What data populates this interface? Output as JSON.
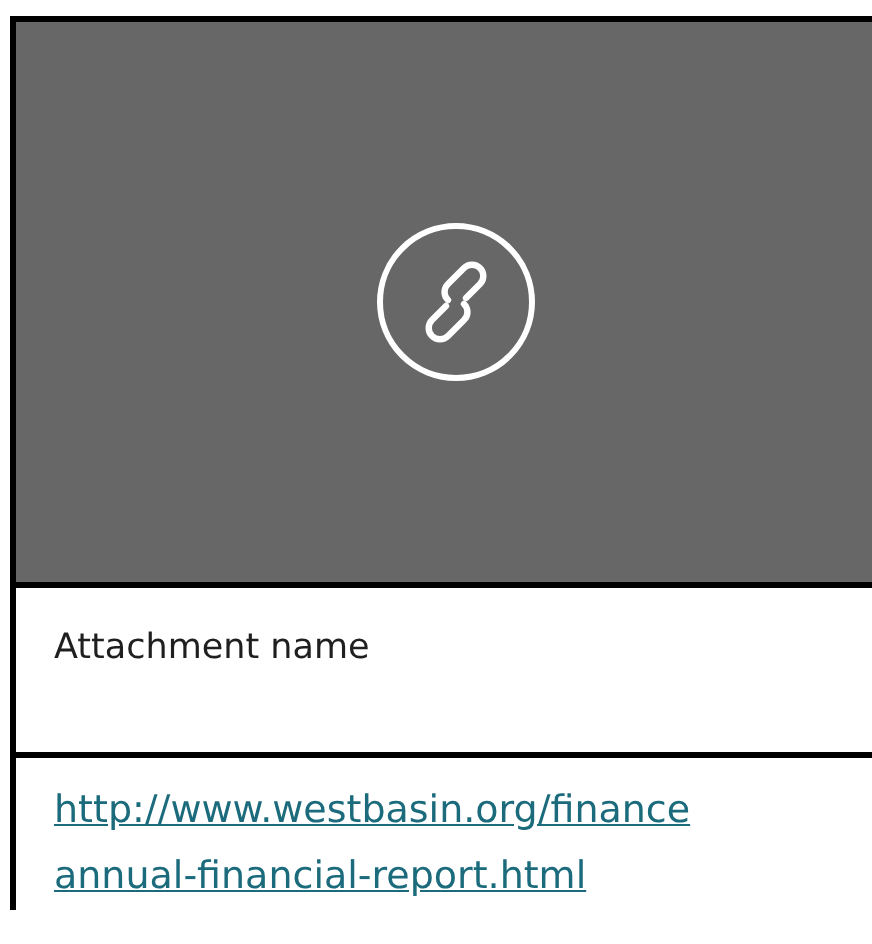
{
  "attachment": {
    "preview": {
      "kind": "link"
    },
    "name_label": "Attachment name",
    "link_lines": [
      "http://www.westbasin.org/finance",
      "annual-financial-report.html"
    ]
  }
}
